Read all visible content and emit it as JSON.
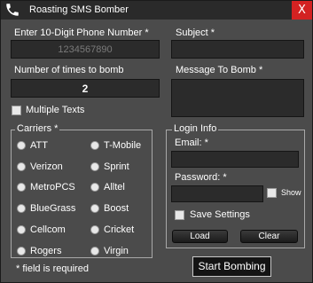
{
  "window": {
    "title": "Roasting SMS Bomber",
    "close_label": "X"
  },
  "phone": {
    "label": "Enter 10-Digit Phone Number *",
    "placeholder": "1234567890"
  },
  "subject": {
    "label": "Subject *",
    "value": ""
  },
  "times": {
    "label": "Number of times to bomb",
    "value": "2"
  },
  "message": {
    "label": "Message To Bomb *",
    "value": ""
  },
  "multiple_texts": {
    "label": "Multiple Texts",
    "checked": false
  },
  "carriers": {
    "title": "Carriers *",
    "left": [
      "ATT",
      "Verizon",
      "MetroPCS",
      "BlueGrass",
      "Cellcom",
      "Rogers"
    ],
    "right": [
      "T-Mobile",
      "Sprint",
      "Alltel",
      "Boost",
      "Cricket",
      "Virgin"
    ]
  },
  "login": {
    "title": "Login Info",
    "email_label": "Email: *",
    "password_label": "Password: *",
    "show_label": "Show",
    "save_label": "Save Settings",
    "load_label": "Load",
    "clear_label": "Clear"
  },
  "footer": {
    "required_note": "* field is required",
    "start_label": "Start Bombing"
  }
}
